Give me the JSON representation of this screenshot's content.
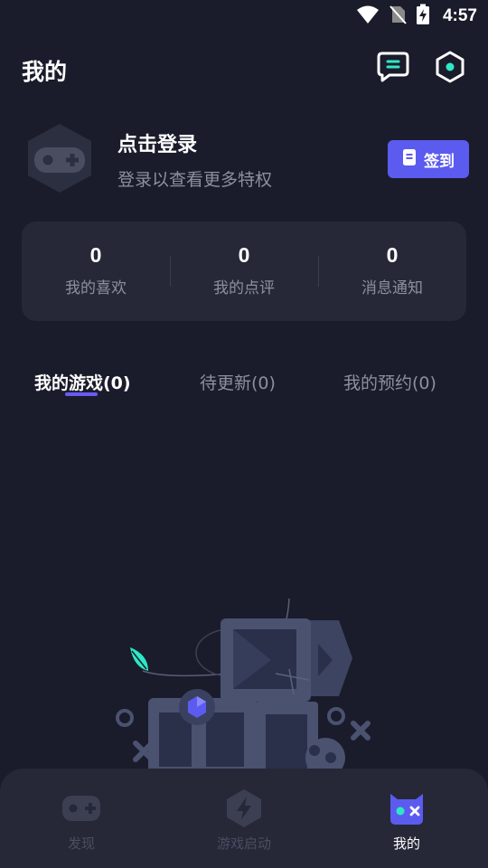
{
  "status_bar": {
    "time": "4:57",
    "icons": [
      "wifi-icon",
      "no-sim-icon",
      "battery-charging-icon"
    ]
  },
  "header": {
    "title": "我的",
    "icons": [
      "message-icon",
      "settings-icon"
    ]
  },
  "profile": {
    "title": "点击登录",
    "subtitle": "登录以查看更多特权",
    "signin_label": "签到",
    "avatar_icon": "gamepad-avatar-icon"
  },
  "stats": [
    {
      "value": "0",
      "label": "我的喜欢"
    },
    {
      "value": "0",
      "label": "我的点评"
    },
    {
      "value": "0",
      "label": "消息通知"
    }
  ],
  "tabs": [
    {
      "label": "我的游戏(0)",
      "active": true
    },
    {
      "label": "待更新(0)",
      "active": false
    },
    {
      "label": "我的预约(0)",
      "active": false
    }
  ],
  "bottom_nav": [
    {
      "label": "发现",
      "icon": "gamepad-icon",
      "active": false
    },
    {
      "label": "游戏启动",
      "icon": "lightning-hexagon-icon",
      "active": false
    },
    {
      "label": "我的",
      "icon": "face-icon",
      "active": true
    }
  ],
  "colors": {
    "background": "#1a1c2b",
    "card": "#262838",
    "accent": "#5b5bf0",
    "muted": "#8d8fa0",
    "teal": "#2ee8c5"
  }
}
